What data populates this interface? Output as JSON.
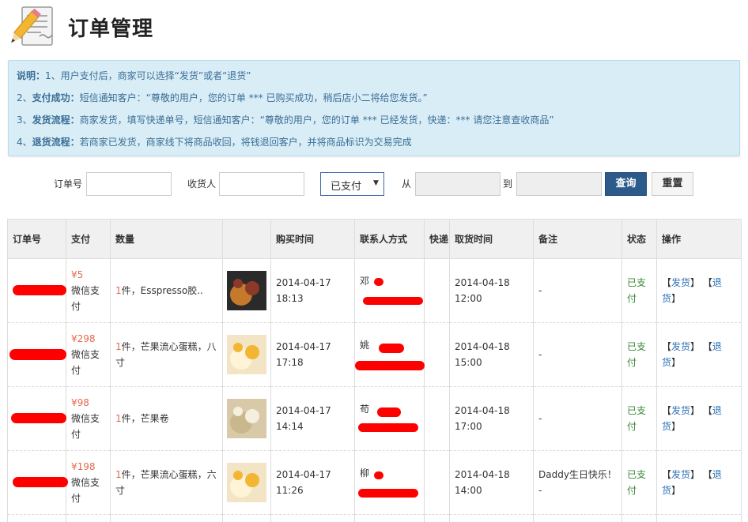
{
  "header": {
    "title": "订单管理"
  },
  "notice": {
    "l1_label": "说明：",
    "l1_text": "1、用户支付后，商家可以选择“发货”或者“退货”",
    "l2_prefix": "2、",
    "l2_label": "支付成功：",
    "l2_text": "短信通知客户：“尊敬的用户，您的订单 *** 已购买成功，稍后店小二将给您发货。”",
    "l3_prefix": "3、",
    "l3_label": "发货流程：",
    "l3_text": "商家发货，填写快递单号，短信通知客户：“尊敬的用户，您的订单 *** 已经发货，快递：*** 请您注意查收商品”",
    "l4_prefix": "4、",
    "l4_label": "退货流程：",
    "l4_text": "若商家已发货，商家线下将商品收回，将钱退回客户，并将商品标识为交易完成"
  },
  "filter": {
    "order_label": "订单号",
    "receiver_label": "收货人",
    "status_value": "已支付",
    "from_label": "从",
    "to_label": "到",
    "query_label": "查询",
    "reset_label": "重置"
  },
  "table": {
    "headers": [
      "订单号",
      "支付",
      "数量",
      "",
      "购买时间",
      "联系人方式",
      "快递",
      "取货时间",
      "备注",
      "状态",
      "操作"
    ],
    "rows": [
      {
        "price": "¥5",
        "pay1": "微信支",
        "pay2": "付",
        "qty": "1",
        "item": "件，Esspresso胶..",
        "item2": "",
        "buy_date": "2014-04-17",
        "buy_time": "18:13",
        "contact": "邓",
        "pick_date": "2014-04-18",
        "pick_time": "12:00",
        "note": "-",
        "note2": "",
        "status1": "已支",
        "status2": "付",
        "ship": "发货",
        "ret1": "退",
        "ret2": "货"
      },
      {
        "price": "¥298",
        "pay1": "微信支",
        "pay2": "付",
        "qty": "1",
        "item": "件，芒果流心蛋糕，八",
        "item2": "寸",
        "buy_date": "2014-04-17",
        "buy_time": "17:18",
        "contact": "姚",
        "pick_date": "2014-04-18",
        "pick_time": "15:00",
        "note": "-",
        "note2": "",
        "status1": "已支",
        "status2": "付",
        "ship": "发货",
        "ret1": "退",
        "ret2": "货"
      },
      {
        "price": "¥98",
        "pay1": "微信支",
        "pay2": "付",
        "qty": "1",
        "item": "件，芒果卷",
        "item2": "",
        "buy_date": "2014-04-17",
        "buy_time": "14:14",
        "contact": "苟",
        "pick_date": "2014-04-18",
        "pick_time": "17:00",
        "note": "-",
        "note2": "",
        "status1": "已支",
        "status2": "付",
        "ship": "发货",
        "ret1": "退",
        "ret2": "货"
      },
      {
        "price": "¥198",
        "pay1": "微信支",
        "pay2": "付",
        "qty": "1",
        "item": "件，芒果流心蛋糕，六",
        "item2": "寸",
        "buy_date": "2014-04-17",
        "buy_time": "11:26",
        "contact": "柳",
        "pick_date": "2014-04-18",
        "pick_time": "14:00",
        "note": "Daddy生日快乐！",
        "note2": "-",
        "status1": "已支",
        "status2": "付",
        "ship": "发货",
        "ret1": "退",
        "ret2": "货"
      }
    ]
  },
  "colors": {
    "notice_bg": "#d9edf7",
    "query_btn": "#2c5a8a",
    "price": "#e06a50",
    "status": "#3a8a3a",
    "link": "#2a70b8",
    "redaction": "#ff0000"
  }
}
